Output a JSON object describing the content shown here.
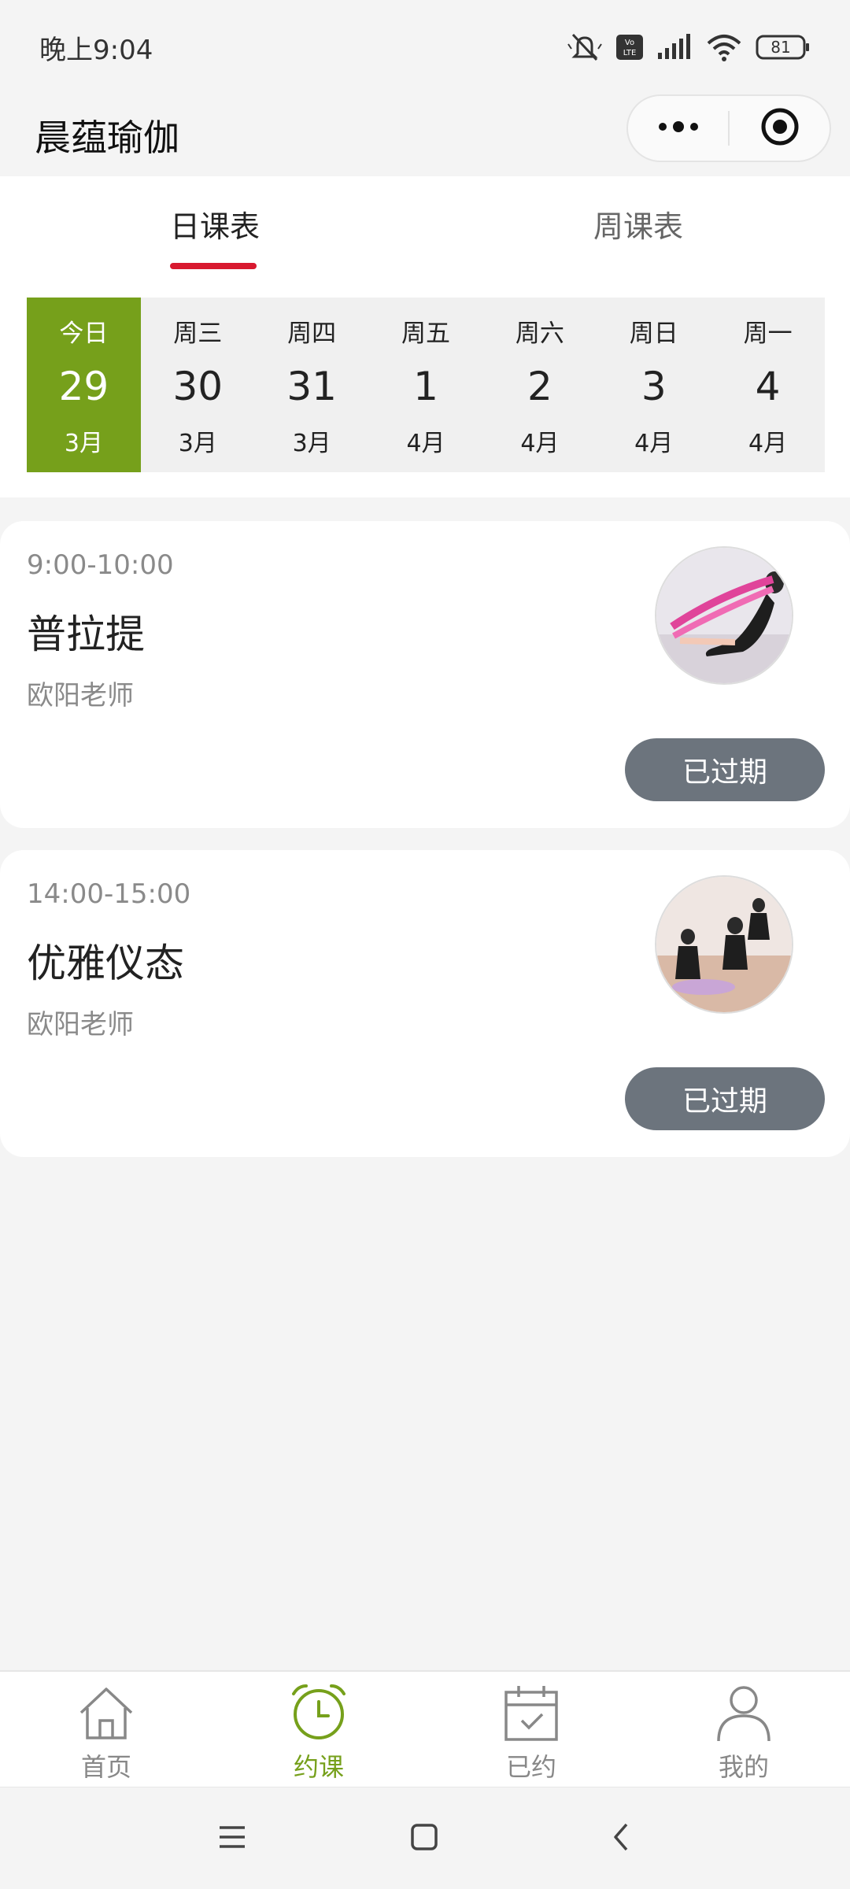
{
  "status_bar": {
    "time": "晚上9:04",
    "battery": "81",
    "icons": [
      "mute-icon",
      "volte-icon",
      "signal-icon",
      "wifi-icon",
      "battery-icon"
    ]
  },
  "header": {
    "title": "晨蕴瑜伽",
    "menu_icon": "more-dots-icon",
    "close_icon": "target-circle-icon"
  },
  "tabs": [
    {
      "label": "日课表",
      "active": true
    },
    {
      "label": "周课表",
      "active": false
    }
  ],
  "dates": [
    {
      "week": "今日",
      "day": "29",
      "month": "3月",
      "active": true
    },
    {
      "week": "周三",
      "day": "30",
      "month": "3月"
    },
    {
      "week": "周四",
      "day": "31",
      "month": "3月"
    },
    {
      "week": "周五",
      "day": "1",
      "month": "4月"
    },
    {
      "week": "周六",
      "day": "2",
      "month": "4月"
    },
    {
      "week": "周日",
      "day": "3",
      "month": "4月"
    },
    {
      "week": "周一",
      "day": "4",
      "month": "4月"
    }
  ],
  "courses": [
    {
      "time": "9:00-10:00",
      "name": "普拉提",
      "teacher": "欧阳老师",
      "status": "已过期",
      "photo": "pilates-photo"
    },
    {
      "time": "14:00-15:00",
      "name": "优雅仪态",
      "teacher": "欧阳老师",
      "status": "已过期",
      "photo": "posture-class-photo"
    }
  ],
  "tabbar": [
    {
      "label": "首页",
      "icon": "home-icon",
      "active": false
    },
    {
      "label": "约课",
      "icon": "alarm-clock-icon",
      "active": true
    },
    {
      "label": "已约",
      "icon": "calendar-check-icon",
      "active": false
    },
    {
      "label": "我的",
      "icon": "user-icon",
      "active": false
    }
  ],
  "colors": {
    "accent_green": "#76a01b",
    "tab_underline_red": "#d8192f",
    "expired_button": "#6c747d"
  }
}
